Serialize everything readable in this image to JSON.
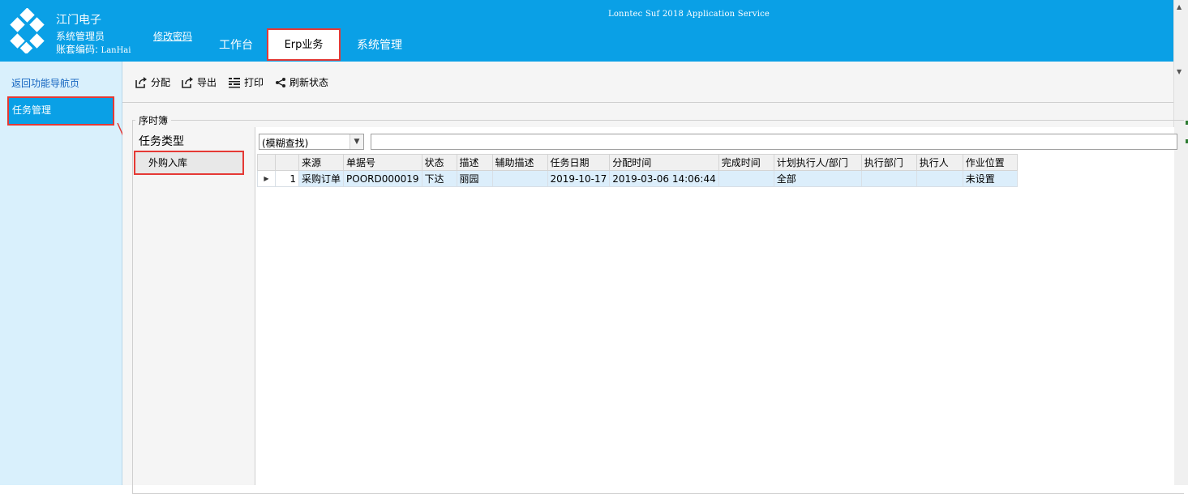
{
  "header": {
    "company": "江门电子",
    "user": "系统管理员",
    "account_label": "账套编码:",
    "account_code": "LanHai",
    "change_password": "修改密码",
    "app_title": "Lonntec Suf 2018 Application Service",
    "tabs": [
      {
        "label": "工作台",
        "active": false
      },
      {
        "label": "Erp业务",
        "active": true
      },
      {
        "label": "系统管理",
        "active": false
      }
    ]
  },
  "sidebar": {
    "back_link": "返回功能导航页",
    "items": [
      {
        "label": "任务管理",
        "active": true
      }
    ]
  },
  "toolbar": {
    "buttons": [
      {
        "label": "分配",
        "icon": "share-icon"
      },
      {
        "label": "导出",
        "icon": "export-icon"
      },
      {
        "label": "打印",
        "icon": "print-icon"
      },
      {
        "label": "刷新状态",
        "icon": "refresh-share-icon"
      }
    ]
  },
  "panel": {
    "group_title": "序时簿",
    "type_title": "任务类型",
    "type_items": [
      "外购入库"
    ]
  },
  "search": {
    "mode_value": "(模糊查找)",
    "input_value": ""
  },
  "grid": {
    "columns": [
      "来源",
      "单据号",
      "状态",
      "描述",
      "辅助描述",
      "任务日期",
      "分配时间",
      "完成时间",
      "计划执行人/部门",
      "执行部门",
      "执行人",
      "作业位置"
    ],
    "rows": [
      {
        "index": "1",
        "cells": [
          "采购订单",
          "POORD000019",
          "下达",
          "丽园",
          "",
          "2019-10-17",
          "2019-03-06 14:06:44",
          "",
          "全部",
          "",
          "",
          "未设置"
        ]
      }
    ]
  },
  "colors": {
    "header_blue": "#0aa0e6",
    "sidebar_bg": "#d9f0fc",
    "highlight_red": "#e53935",
    "row_selected": "#dceefb"
  }
}
